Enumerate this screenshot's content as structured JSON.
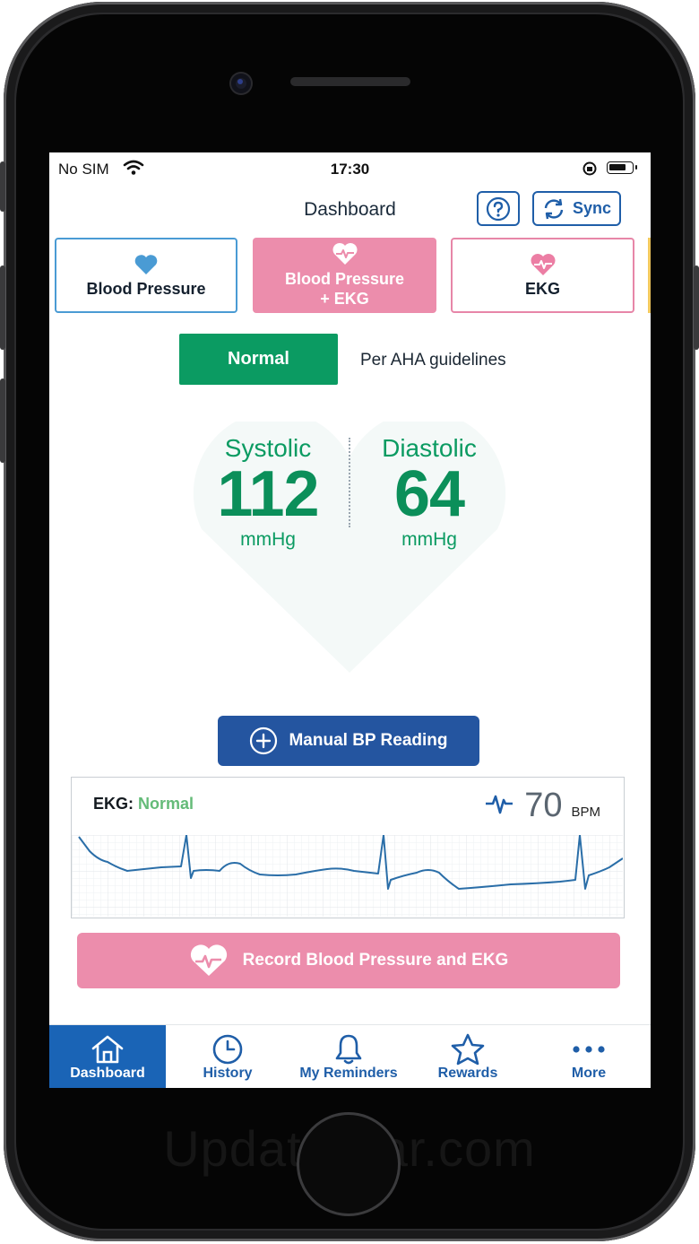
{
  "status_bar": {
    "carrier": "No SIM",
    "time": "17:30"
  },
  "header": {
    "title": "Dashboard",
    "sync_label": "Sync",
    "help_icon": "question-circle-icon",
    "sync_icon": "sync-arrows-icon"
  },
  "modes": [
    {
      "label": "Blood Pressure",
      "icon": "heart-icon",
      "color": "#4a9bd4"
    },
    {
      "label_line1": "Blood Pressure",
      "label_line2": "+ EKG",
      "icon": "heart-pulse-icon",
      "color": "#ec8dac"
    },
    {
      "label": "EKG",
      "icon": "heart-pulse-icon",
      "color": "#e786a8"
    }
  ],
  "classification": {
    "badge": "Normal",
    "note": "Per AHA guidelines",
    "color": "#0b9b62"
  },
  "reading": {
    "systolic_label": "Systolic",
    "systolic_value": "112",
    "systolic_unit": "mmHg",
    "diastolic_label": "Diastolic",
    "diastolic_value": "64",
    "diastolic_unit": "mmHg"
  },
  "manual_button": {
    "label": "Manual BP Reading",
    "icon": "plus-circle-icon"
  },
  "ekg": {
    "label": "EKG:",
    "status": "Normal",
    "bpm_value": "70",
    "bpm_unit": "BPM",
    "icon": "pulse-icon"
  },
  "record_button": {
    "label": "Record Blood Pressure and EKG",
    "icon": "heart-pulse-icon"
  },
  "tabs": [
    {
      "label": "Dashboard",
      "icon": "home-icon",
      "active": true
    },
    {
      "label": "History",
      "icon": "clock-icon"
    },
    {
      "label": "My Reminders",
      "icon": "bell-icon"
    },
    {
      "label": "Rewards",
      "icon": "star-icon"
    },
    {
      "label": "More",
      "icon": "more-dots-icon"
    }
  ],
  "watermark": "UpdateStar.com"
}
